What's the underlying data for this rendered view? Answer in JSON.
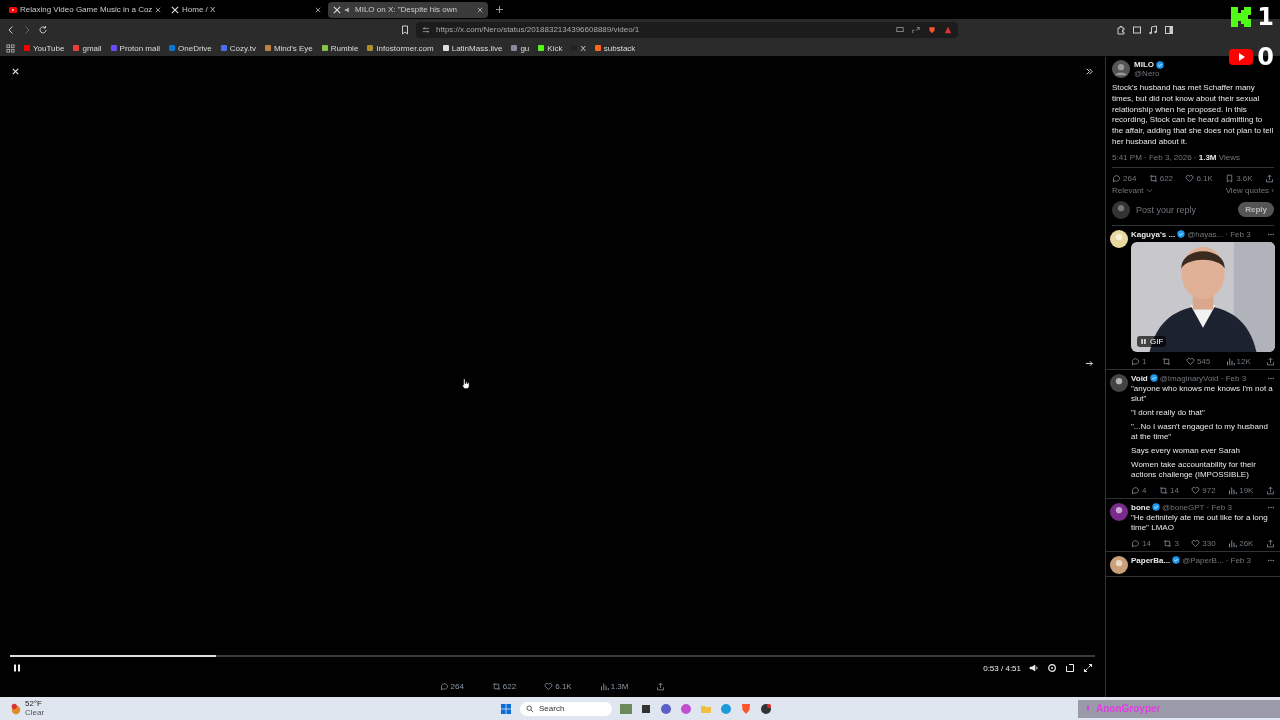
{
  "tabs": [
    {
      "kind": "youtube",
      "title": "Relaxing Video Game Music in a Coz",
      "selected": false
    },
    {
      "kind": "x",
      "title": "Home / X",
      "selected": false
    },
    {
      "kind": "x",
      "title": "MILO on X: \"Despite his own",
      "selected": true
    }
  ],
  "address": {
    "url": "https://x.com/Nero/status/2018832134396608889/video/1"
  },
  "bookmarks": [
    "YouTube",
    "gmail",
    "Proton mail",
    "OneDrive",
    "Cozy.tv",
    "Mind's Eye",
    "Rumble",
    "Infostormer.com",
    "LatinMass.live",
    "gu",
    "Kick",
    "X",
    "substack"
  ],
  "overlays": [
    {
      "kind": "kick",
      "count": "1"
    },
    {
      "kind": "youtube",
      "count": "0"
    }
  ],
  "video": {
    "progress": {
      "level": 0.19
    },
    "playing": true,
    "time": "0:53 / 4:51",
    "stats": [
      {
        "kind": "reply",
        "count": "264"
      },
      {
        "kind": "repost",
        "count": "622"
      },
      {
        "kind": "like",
        "count": "6.1K"
      },
      {
        "kind": "views",
        "count": "1.3M"
      }
    ]
  },
  "post": {
    "author": "MILO",
    "handle": "@Nero",
    "text": "Stock's husband has met Schaffer many times, but did not know about their sexual relationship when he proposed. In this recording, Stock can be heard admitting to the affair, adding that she does not plan to tell her husband about it.",
    "time": "5:41 PM · Feb 3, 2026 · ",
    "views": "1.3M",
    "views_label": "Views",
    "actions": [
      {
        "kind": "reply",
        "count": "264"
      },
      {
        "kind": "repost",
        "count": "622"
      },
      {
        "kind": "like",
        "count": "6.1K"
      },
      {
        "kind": "bookmark",
        "count": "3.6K"
      }
    ],
    "sort": "Relevant",
    "quotes": "View quotes ›",
    "reply_placeholder": "Post your reply",
    "reply_button": "Reply"
  },
  "replies": [
    {
      "name": "Kaguya's ...",
      "handle": "@hayas...",
      "date": "· Feb 3",
      "media": {
        "kind": "picture",
        "badge": "GIF"
      },
      "stats": [
        {
          "kind": "reply",
          "count": "1"
        },
        {
          "kind": "repost"
        },
        {
          "kind": "like",
          "count": "545"
        },
        {
          "kind": "views",
          "count": "12K"
        }
      ]
    },
    {
      "name": "Void",
      "handle": "@ImaginaryVoid · Feb 3",
      "paragraphs": [
        "\"anyone who knows me knows I'm not a slut\"",
        "\"I dont really do that\"",
        "\"...No I wasn't engaged to my husband at the time\"",
        "Says every woman ever Sarah",
        "Women take accountability for their actions challenge (IMPOSSIBLE)"
      ],
      "stats": [
        {
          "kind": "reply",
          "count": "4"
        },
        {
          "kind": "repost",
          "count": "14"
        },
        {
          "kind": "like",
          "count": "972"
        },
        {
          "kind": "views",
          "count": "19K"
        }
      ]
    },
    {
      "name": "bone",
      "handle": "@boneGPT · Feb 3",
      "paragraphs": [
        "\"He definitely ate me out like for a long time\" LMAO"
      ],
      "stats": [
        {
          "kind": "reply",
          "count": "14"
        },
        {
          "kind": "repost",
          "count": "3"
        },
        {
          "kind": "like",
          "count": "330"
        },
        {
          "kind": "views",
          "count": "26K"
        }
      ]
    },
    {
      "name": "PaperBa...",
      "handle": "@PaperB...",
      "date": "· Feb 3"
    }
  ],
  "taskbar": {
    "temp": "52°F",
    "weather": "Clear",
    "search": "Search",
    "user": "AnonGroyper"
  }
}
